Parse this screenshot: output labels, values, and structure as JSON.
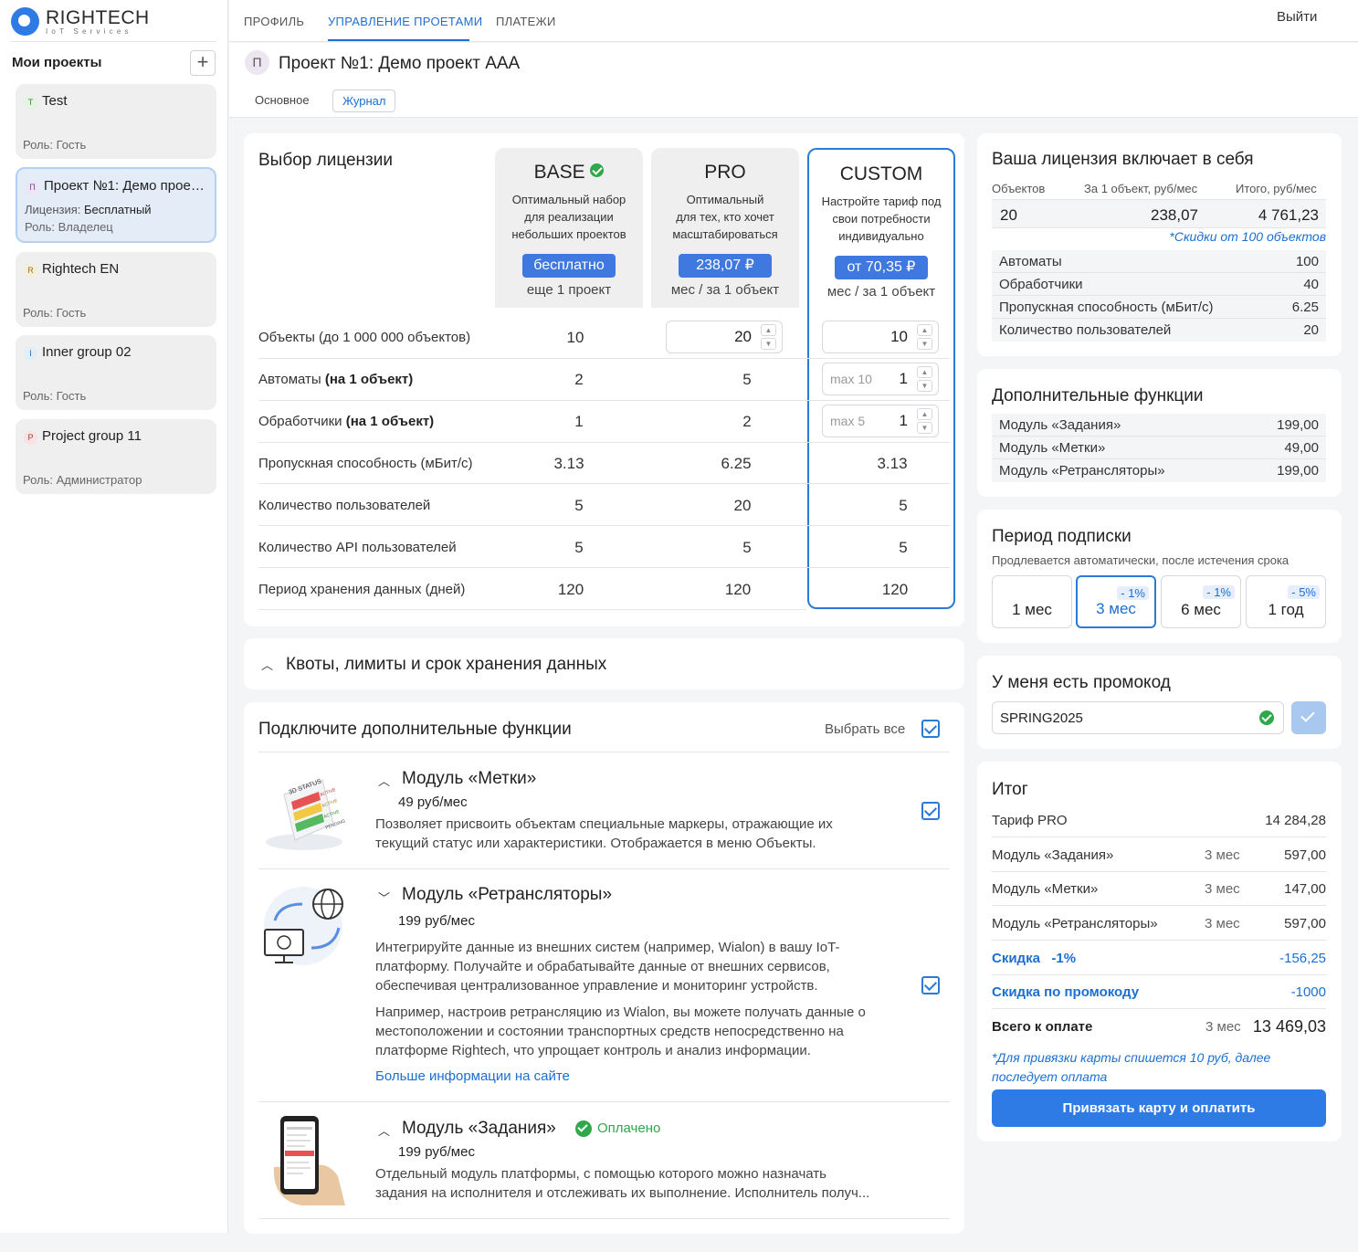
{
  "app": {
    "logo_title": "RIGHTECH",
    "logo_sub": "IoT Services"
  },
  "sidebar": {
    "heading": "Мои проекты",
    "add_label": "+",
    "projects": [
      {
        "badge": "T",
        "name": "Test",
        "license_label": "",
        "license": "",
        "role": "Роль: Гость"
      },
      {
        "badge": "П",
        "name": "Проект №1: Демо проект AAA",
        "license_label": "Лицензия: ",
        "license": "Бесплатный",
        "role": "Роль: Владелец"
      },
      {
        "badge": "R",
        "name": "Rightech EN",
        "license_label": "",
        "license": "",
        "role": "Роль: Гость"
      },
      {
        "badge": "I",
        "name": "Inner group 02",
        "license_label": "",
        "license": "",
        "role": "Роль: Гость"
      },
      {
        "badge": "P",
        "name": "Project group 11",
        "license_label": "",
        "license": "",
        "role": "Роль: Администратор"
      }
    ]
  },
  "topnav": {
    "tabs": [
      "ПРОФИЛЬ",
      "УПРАВЛЕНИЕ ПРОЕТАМИ",
      "ПЛАТЕЖИ"
    ],
    "logout": "Выйти"
  },
  "project": {
    "avatar": "П",
    "title": "Проект №1: Демо проект AAA",
    "subtabs": [
      "Основное",
      "Журнал"
    ]
  },
  "license": {
    "title": "Выбор лицензии",
    "plans": [
      {
        "name": "BASE",
        "desc": [
          "Оптимальный набор",
          "для реализации",
          "небольших проектов"
        ],
        "price": "бесплатно",
        "unit": "еще 1 проект"
      },
      {
        "name": "PRO",
        "desc": [
          "Оптимальный",
          "для тех, кто хочет",
          "масштабироваться"
        ],
        "price": "238,07 ₽",
        "unit": "мес / за 1 объект"
      },
      {
        "name": "CUSTOM",
        "desc": [
          "Настройте тариф под",
          "свои потребности",
          "индивидуально"
        ],
        "price": "от 70,35 ₽",
        "unit": "мес / за 1 объект"
      }
    ],
    "rows": [
      {
        "label": "Объекты (до 1 000 000 объектов)",
        "bold": "",
        "base": "10",
        "pro": "20",
        "custom": "10"
      },
      {
        "label": "Автоматы ",
        "bold": "(на 1 объект)",
        "base": "2",
        "pro": "5",
        "custom": "1",
        "custom_ph": "max 10"
      },
      {
        "label": "Обработчики ",
        "bold": "(на 1 объект)",
        "base": "1",
        "pro": "2",
        "custom": "1",
        "custom_ph": "max 5"
      },
      {
        "label": "Пропускная способность (мБит/с)",
        "bold": "",
        "base": "3.13",
        "pro": "6.25",
        "custom": "3.13"
      },
      {
        "label": "Количество пользователей",
        "bold": "",
        "base": "5",
        "pro": "20",
        "custom": "5"
      },
      {
        "label": "Количество API пользователей",
        "bold": "",
        "base": "5",
        "pro": "5",
        "custom": "5"
      },
      {
        "label": "Период хранения данных (дней)",
        "bold": "",
        "base": "120",
        "pro": "120",
        "custom": "120"
      }
    ]
  },
  "quotas": {
    "title": "Квоты, лимиты и срок хранения данных"
  },
  "addons": {
    "title": "Подключите дополнительные функции",
    "select_all": "Выбрать все",
    "modules": [
      {
        "title": "Модуль «Метки»",
        "price": "49 руб/мес",
        "desc": [
          "Позволяет присвоить объектам специальные маркеры, отражающие их",
          "текущий статус или характеристики. Отображается в меню Объекты."
        ]
      },
      {
        "title": "Модуль «Ретрансляторы»",
        "price": "199 руб/мес",
        "desc": [
          "Интегрируйте данные из внешних систем (например, Wialon) в вашу IoT-",
          "платформу. Получайте и обрабатывайте данные от внешних сервисов,",
          "обеспечивая централизованное управление и мониторинг устройств."
        ],
        "desc2": [
          "Например, настроив ретрансляцию из Wialon, вы можете получать данные о",
          "местоположении и состоянии транспортных средств непосредственно на",
          "платформе Rightech, что упрощает контроль и анализ информации."
        ],
        "link": "Больше информации на сайте"
      },
      {
        "title": "Модуль «Задания»",
        "paid": "Оплачено",
        "price": "199 руб/мес",
        "desc": [
          "Отдельный модуль платформы, с помощью которого можно назначать",
          "задания на исполнителя и отслеживать их выполнение. Исполнитель получ..."
        ]
      }
    ],
    "image_text": {
      "status": "3D STATUS",
      "tags": [
        "ACTIVE",
        "ACTIVE",
        "ACTIVE",
        "PENDING"
      ]
    }
  },
  "summary": {
    "title": "Ваша лицензия включает в себя",
    "head": [
      "Объектов",
      "За 1 объект, руб/мес",
      "Итого, руб/мес"
    ],
    "values": [
      "20",
      "238,07",
      "4 761,23"
    ],
    "note": "*Скидки от 100 объектов",
    "items": [
      [
        "Автоматы",
        "100"
      ],
      [
        "Обработчики",
        "40"
      ],
      [
        "Пропускная способность (мБит/с)",
        "6.25"
      ],
      [
        "Количество пользователей",
        "20"
      ]
    ]
  },
  "extra": {
    "title": "Дополнительные функции",
    "items": [
      [
        "Модуль «Задания»",
        "199,00"
      ],
      [
        "Модуль «Метки»",
        "49,00"
      ],
      [
        "Модуль «Ретрансляторы»",
        "199,00"
      ]
    ]
  },
  "period": {
    "title": "Период подписки",
    "sub": "Продлевается автоматически, после истечения срока",
    "options": [
      {
        "label": "1 мес",
        "disc": ""
      },
      {
        "label": "3 мес",
        "disc": "- 1%"
      },
      {
        "label": "6 мес",
        "disc": "- 1%"
      },
      {
        "label": "1 год",
        "disc": "- 5%"
      }
    ]
  },
  "promo": {
    "title": "У меня есть промокод",
    "value": "SPRING2025"
  },
  "total": {
    "title": "Итог",
    "rows": [
      {
        "label": "Тариф PRO",
        "period": "",
        "value": "14 284,28"
      },
      {
        "label": "Модуль «Задания»",
        "period": "3 мес",
        "value": "597,00"
      },
      {
        "label": "Модуль «Метки»",
        "period": "3 мес",
        "value": "147,00"
      },
      {
        "label": "Модуль «Ретрансляторы»",
        "period": "3 мес",
        "value": "597,00"
      },
      {
        "label": "Скидка   -1%",
        "period": "",
        "value": "-156,25"
      },
      {
        "label": "Скидка по промокоду",
        "period": "",
        "value": "-1000"
      }
    ],
    "grand_label": "Всего к оплате",
    "grand_period": "3 мес",
    "grand_value": "13 469,03",
    "note": [
      "*Для привязки карты спишется 10 руб, далее",
      "последует оплата"
    ],
    "pay_button": "Привязать карту и оплатить"
  },
  "colors": {
    "accent": "#1c6fd1",
    "button": "#3f78df",
    "green": "#2ea84a"
  }
}
